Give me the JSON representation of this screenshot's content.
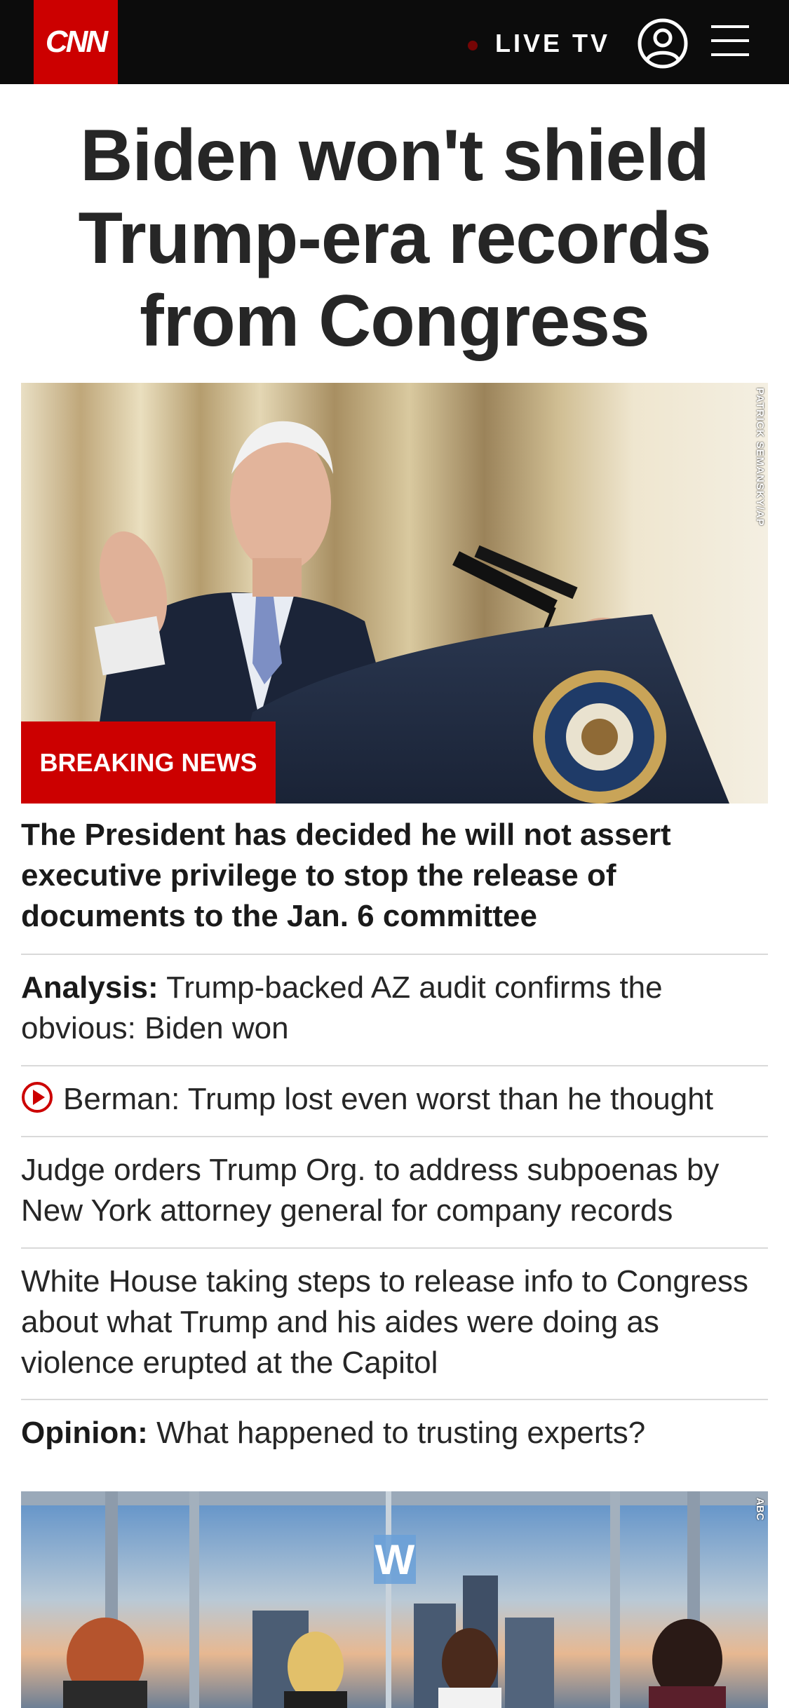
{
  "nav": {
    "logo_text": "CNN",
    "live_tv_label": "LIVE TV",
    "account_icon": "account-icon",
    "menu_icon": "menu-icon"
  },
  "headline": "Biden won't shield Trump-era records from Congress",
  "hero": {
    "photo_credit": "PATRICK SEMANSKY/AP",
    "badge": "BREAKING NEWS"
  },
  "lead_summary": "The President has decided he will not assert executive privilege to stop the release of documents to the Jan. 6 committee",
  "stories": [
    {
      "kicker": "Analysis:",
      "text": "Trump-backed AZ audit confirms the obvious: Biden won",
      "video": false
    },
    {
      "kicker": "",
      "text": "Berman: Trump lost even worst than he thought",
      "video": true
    },
    {
      "kicker": "",
      "text": "Judge orders Trump Org. to address subpoenas by New York attorney general for company records",
      "video": false
    },
    {
      "kicker": "",
      "text": "White House taking steps to release info to Congress about what Trump and his aides were doing as violence erupted at the Capitol",
      "video": false
    },
    {
      "kicker": "Opinion:",
      "text": "What happened to trusting experts?",
      "video": false
    }
  ],
  "promo": {
    "photo_credit": "ABC"
  },
  "colors": {
    "brand_red": "#cc0000",
    "nav_background": "#0c0c0c",
    "divider": "#d9d9d9"
  }
}
